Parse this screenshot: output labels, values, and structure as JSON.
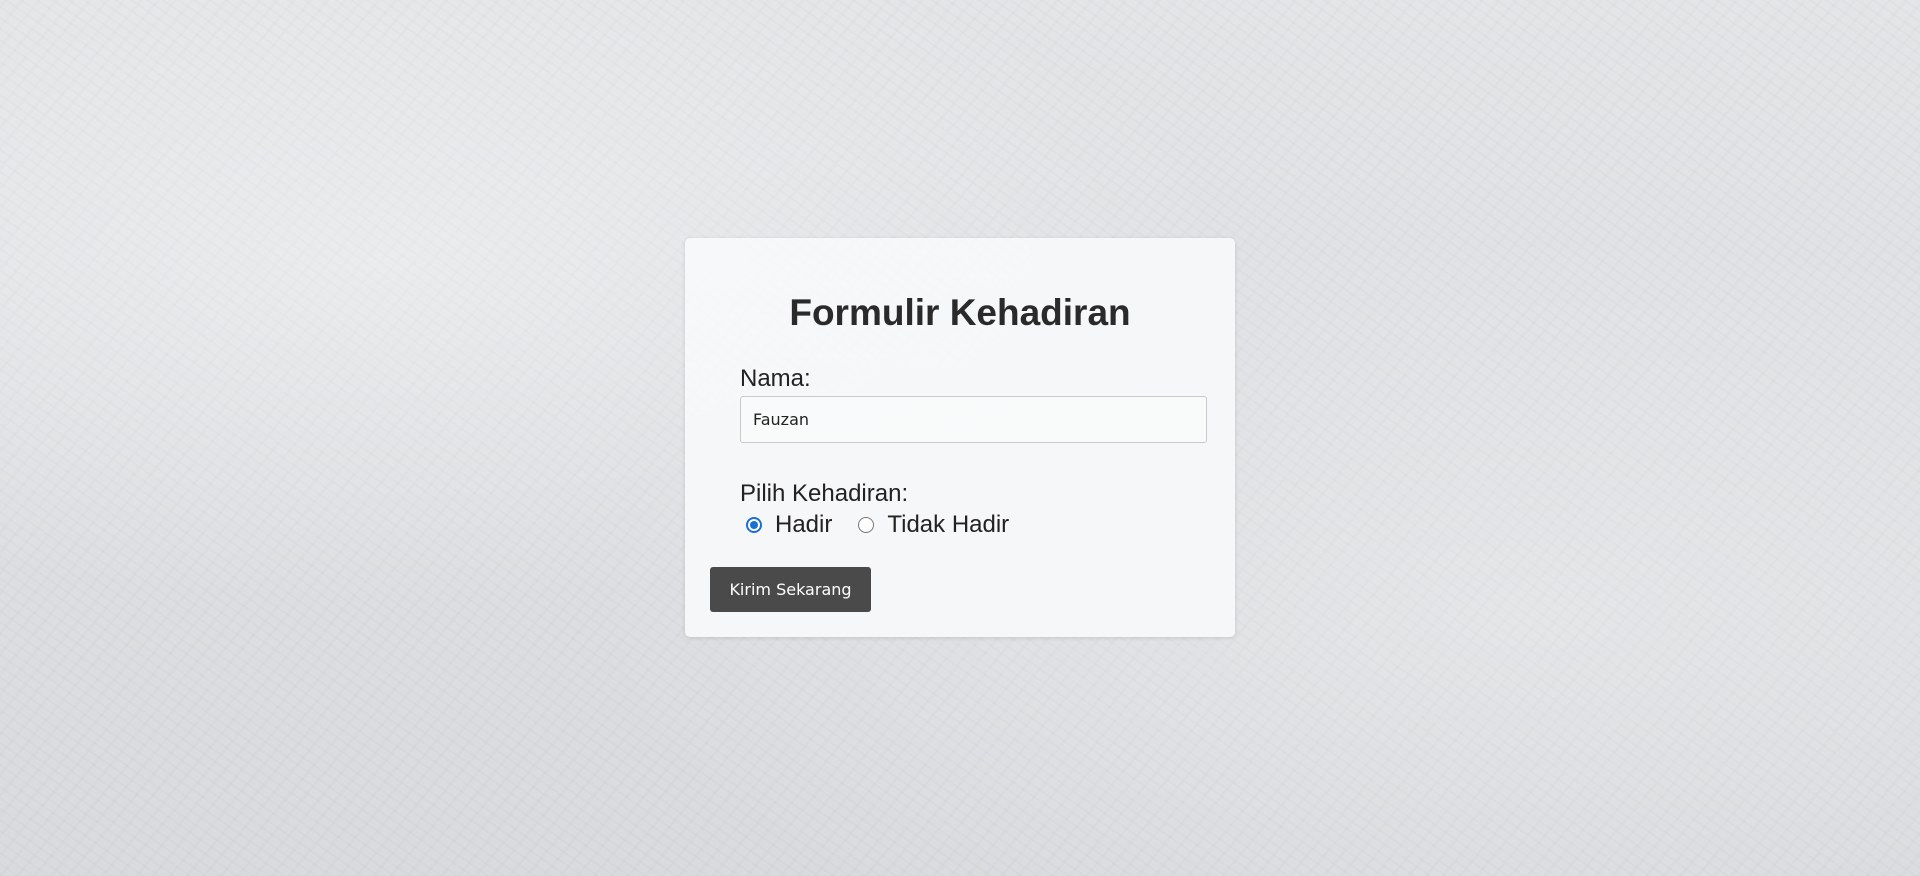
{
  "form": {
    "title": "Formulir Kehadiran",
    "name_label": "Nama:",
    "name_value": "Fauzan",
    "attendance_label": "Pilih Kehadiran:",
    "options": [
      {
        "label": "Hadir",
        "checked": true
      },
      {
        "label": "Tidak Hadir",
        "checked": false
      }
    ],
    "submit_label": "Kirim Sekarang"
  },
  "colors": {
    "accent": "#1a6fd4",
    "button_background": "#4a4a4a",
    "card_background": "#f8f9fa"
  }
}
